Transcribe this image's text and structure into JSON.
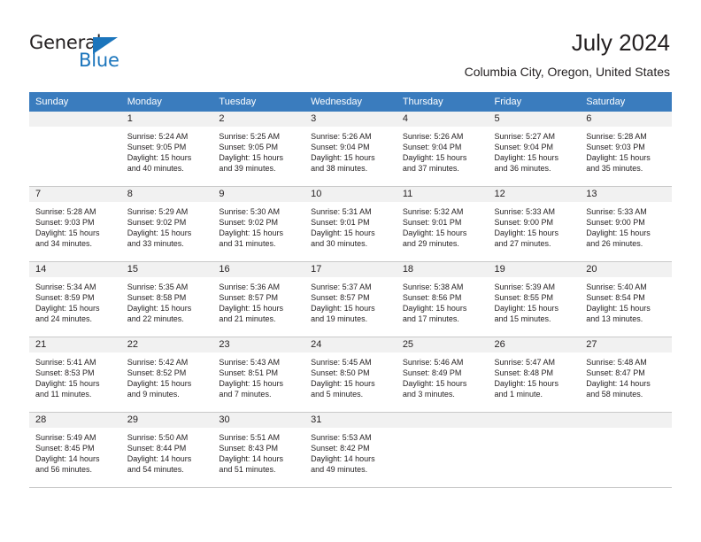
{
  "brand": {
    "name_part1": "General",
    "name_part2": "Blue",
    "triangle_color": "#1b75bc",
    "text_color": "#231f20"
  },
  "header": {
    "title": "July 2024",
    "subtitle": "Columbia City, Oregon, United States"
  },
  "theme": {
    "header_row_bg": "#3a7cbe",
    "header_row_text": "#ffffff",
    "daynum_band_bg": "#f1f1f1",
    "cell_border": "#c9c9c9",
    "body_text": "#231f20"
  },
  "weekdays": [
    "Sunday",
    "Monday",
    "Tuesday",
    "Wednesday",
    "Thursday",
    "Friday",
    "Saturday"
  ],
  "weeks": [
    [
      {
        "day": "",
        "empty": true,
        "sunrise": "",
        "sunset": "",
        "daylight_line1": "",
        "daylight_line2": ""
      },
      {
        "day": "1",
        "sunrise": "Sunrise: 5:24 AM",
        "sunset": "Sunset: 9:05 PM",
        "daylight_line1": "Daylight: 15 hours",
        "daylight_line2": "and 40 minutes."
      },
      {
        "day": "2",
        "sunrise": "Sunrise: 5:25 AM",
        "sunset": "Sunset: 9:05 PM",
        "daylight_line1": "Daylight: 15 hours",
        "daylight_line2": "and 39 minutes."
      },
      {
        "day": "3",
        "sunrise": "Sunrise: 5:26 AM",
        "sunset": "Sunset: 9:04 PM",
        "daylight_line1": "Daylight: 15 hours",
        "daylight_line2": "and 38 minutes."
      },
      {
        "day": "4",
        "sunrise": "Sunrise: 5:26 AM",
        "sunset": "Sunset: 9:04 PM",
        "daylight_line1": "Daylight: 15 hours",
        "daylight_line2": "and 37 minutes."
      },
      {
        "day": "5",
        "sunrise": "Sunrise: 5:27 AM",
        "sunset": "Sunset: 9:04 PM",
        "daylight_line1": "Daylight: 15 hours",
        "daylight_line2": "and 36 minutes."
      },
      {
        "day": "6",
        "sunrise": "Sunrise: 5:28 AM",
        "sunset": "Sunset: 9:03 PM",
        "daylight_line1": "Daylight: 15 hours",
        "daylight_line2": "and 35 minutes."
      }
    ],
    [
      {
        "day": "7",
        "sunrise": "Sunrise: 5:28 AM",
        "sunset": "Sunset: 9:03 PM",
        "daylight_line1": "Daylight: 15 hours",
        "daylight_line2": "and 34 minutes."
      },
      {
        "day": "8",
        "sunrise": "Sunrise: 5:29 AM",
        "sunset": "Sunset: 9:02 PM",
        "daylight_line1": "Daylight: 15 hours",
        "daylight_line2": "and 33 minutes."
      },
      {
        "day": "9",
        "sunrise": "Sunrise: 5:30 AM",
        "sunset": "Sunset: 9:02 PM",
        "daylight_line1": "Daylight: 15 hours",
        "daylight_line2": "and 31 minutes."
      },
      {
        "day": "10",
        "sunrise": "Sunrise: 5:31 AM",
        "sunset": "Sunset: 9:01 PM",
        "daylight_line1": "Daylight: 15 hours",
        "daylight_line2": "and 30 minutes."
      },
      {
        "day": "11",
        "sunrise": "Sunrise: 5:32 AM",
        "sunset": "Sunset: 9:01 PM",
        "daylight_line1": "Daylight: 15 hours",
        "daylight_line2": "and 29 minutes."
      },
      {
        "day": "12",
        "sunrise": "Sunrise: 5:33 AM",
        "sunset": "Sunset: 9:00 PM",
        "daylight_line1": "Daylight: 15 hours",
        "daylight_line2": "and 27 minutes."
      },
      {
        "day": "13",
        "sunrise": "Sunrise: 5:33 AM",
        "sunset": "Sunset: 9:00 PM",
        "daylight_line1": "Daylight: 15 hours",
        "daylight_line2": "and 26 minutes."
      }
    ],
    [
      {
        "day": "14",
        "sunrise": "Sunrise: 5:34 AM",
        "sunset": "Sunset: 8:59 PM",
        "daylight_line1": "Daylight: 15 hours",
        "daylight_line2": "and 24 minutes."
      },
      {
        "day": "15",
        "sunrise": "Sunrise: 5:35 AM",
        "sunset": "Sunset: 8:58 PM",
        "daylight_line1": "Daylight: 15 hours",
        "daylight_line2": "and 22 minutes."
      },
      {
        "day": "16",
        "sunrise": "Sunrise: 5:36 AM",
        "sunset": "Sunset: 8:57 PM",
        "daylight_line1": "Daylight: 15 hours",
        "daylight_line2": "and 21 minutes."
      },
      {
        "day": "17",
        "sunrise": "Sunrise: 5:37 AM",
        "sunset": "Sunset: 8:57 PM",
        "daylight_line1": "Daylight: 15 hours",
        "daylight_line2": "and 19 minutes."
      },
      {
        "day": "18",
        "sunrise": "Sunrise: 5:38 AM",
        "sunset": "Sunset: 8:56 PM",
        "daylight_line1": "Daylight: 15 hours",
        "daylight_line2": "and 17 minutes."
      },
      {
        "day": "19",
        "sunrise": "Sunrise: 5:39 AM",
        "sunset": "Sunset: 8:55 PM",
        "daylight_line1": "Daylight: 15 hours",
        "daylight_line2": "and 15 minutes."
      },
      {
        "day": "20",
        "sunrise": "Sunrise: 5:40 AM",
        "sunset": "Sunset: 8:54 PM",
        "daylight_line1": "Daylight: 15 hours",
        "daylight_line2": "and 13 minutes."
      }
    ],
    [
      {
        "day": "21",
        "sunrise": "Sunrise: 5:41 AM",
        "sunset": "Sunset: 8:53 PM",
        "daylight_line1": "Daylight: 15 hours",
        "daylight_line2": "and 11 minutes."
      },
      {
        "day": "22",
        "sunrise": "Sunrise: 5:42 AM",
        "sunset": "Sunset: 8:52 PM",
        "daylight_line1": "Daylight: 15 hours",
        "daylight_line2": "and 9 minutes."
      },
      {
        "day": "23",
        "sunrise": "Sunrise: 5:43 AM",
        "sunset": "Sunset: 8:51 PM",
        "daylight_line1": "Daylight: 15 hours",
        "daylight_line2": "and 7 minutes."
      },
      {
        "day": "24",
        "sunrise": "Sunrise: 5:45 AM",
        "sunset": "Sunset: 8:50 PM",
        "daylight_line1": "Daylight: 15 hours",
        "daylight_line2": "and 5 minutes."
      },
      {
        "day": "25",
        "sunrise": "Sunrise: 5:46 AM",
        "sunset": "Sunset: 8:49 PM",
        "daylight_line1": "Daylight: 15 hours",
        "daylight_line2": "and 3 minutes."
      },
      {
        "day": "26",
        "sunrise": "Sunrise: 5:47 AM",
        "sunset": "Sunset: 8:48 PM",
        "daylight_line1": "Daylight: 15 hours",
        "daylight_line2": "and 1 minute."
      },
      {
        "day": "27",
        "sunrise": "Sunrise: 5:48 AM",
        "sunset": "Sunset: 8:47 PM",
        "daylight_line1": "Daylight: 14 hours",
        "daylight_line2": "and 58 minutes."
      }
    ],
    [
      {
        "day": "28",
        "sunrise": "Sunrise: 5:49 AM",
        "sunset": "Sunset: 8:45 PM",
        "daylight_line1": "Daylight: 14 hours",
        "daylight_line2": "and 56 minutes."
      },
      {
        "day": "29",
        "sunrise": "Sunrise: 5:50 AM",
        "sunset": "Sunset: 8:44 PM",
        "daylight_line1": "Daylight: 14 hours",
        "daylight_line2": "and 54 minutes."
      },
      {
        "day": "30",
        "sunrise": "Sunrise: 5:51 AM",
        "sunset": "Sunset: 8:43 PM",
        "daylight_line1": "Daylight: 14 hours",
        "daylight_line2": "and 51 minutes."
      },
      {
        "day": "31",
        "sunrise": "Sunrise: 5:53 AM",
        "sunset": "Sunset: 8:42 PM",
        "daylight_line1": "Daylight: 14 hours",
        "daylight_line2": "and 49 minutes."
      },
      {
        "day": "",
        "empty": true,
        "sunrise": "",
        "sunset": "",
        "daylight_line1": "",
        "daylight_line2": ""
      },
      {
        "day": "",
        "empty": true,
        "sunrise": "",
        "sunset": "",
        "daylight_line1": "",
        "daylight_line2": ""
      },
      {
        "day": "",
        "empty": true,
        "sunrise": "",
        "sunset": "",
        "daylight_line1": "",
        "daylight_line2": ""
      }
    ]
  ]
}
